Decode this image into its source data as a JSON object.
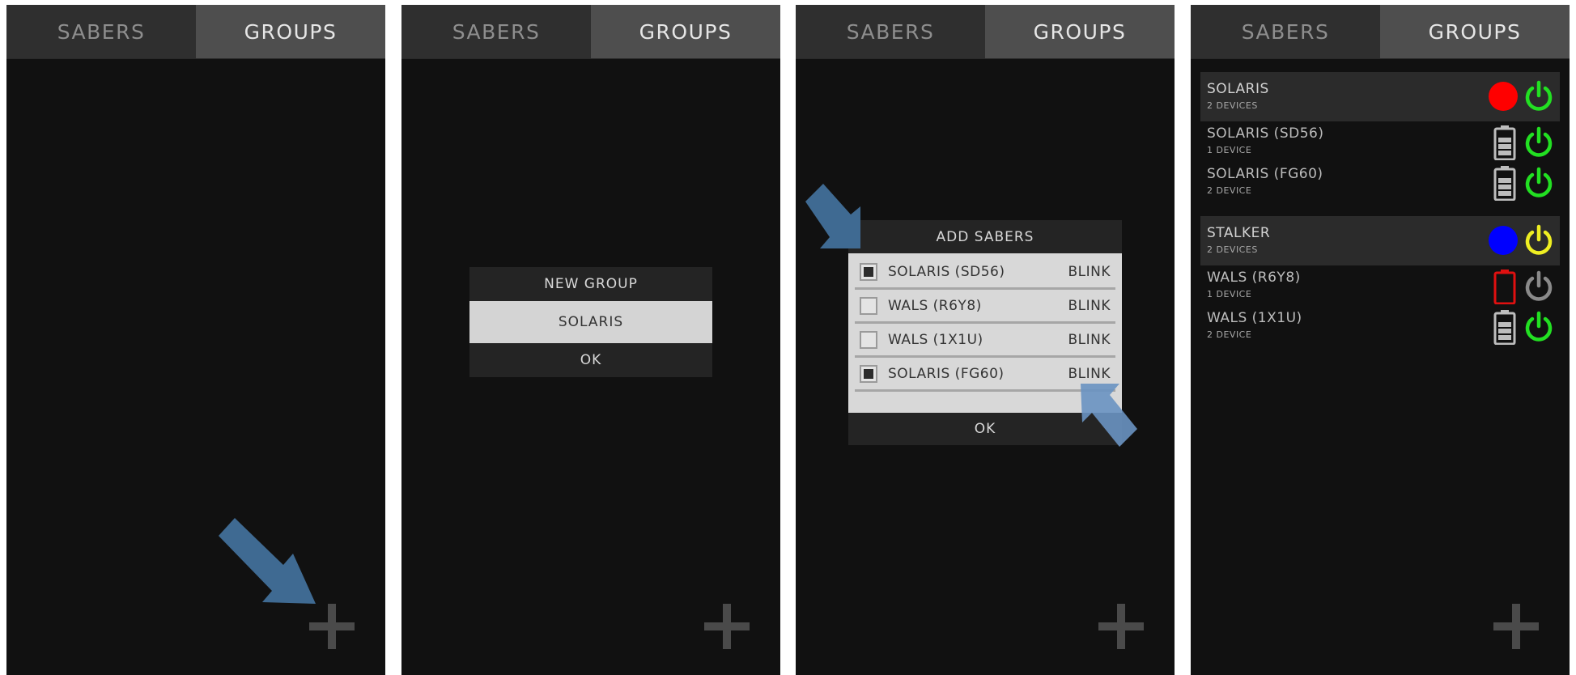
{
  "tabs": {
    "sabers": "SABERS",
    "groups": "GROUPS"
  },
  "colors": {
    "red": "#ff0000",
    "blue": "#0000ff",
    "green": "#22e022",
    "yellow": "#eeee22",
    "gray": "#8a8a8a",
    "arrow": "#3f6a92"
  },
  "new_group_dialog": {
    "title": "NEW GROUP",
    "input_value": "SOLARIS",
    "ok": "OK"
  },
  "add_sabers_dialog": {
    "title": "ADD SABERS",
    "items": [
      {
        "name": "SOLARIS (SD56)",
        "action": "BLINK",
        "checked": true
      },
      {
        "name": "WALS (R6Y8)",
        "action": "BLINK",
        "checked": false
      },
      {
        "name": "WALS (1X1U)",
        "action": "BLINK",
        "checked": false
      },
      {
        "name": "SOLARIS (FG60)",
        "action": "BLINK",
        "checked": true
      }
    ],
    "ok": "OK"
  },
  "groups": [
    {
      "name": "SOLARIS",
      "subtitle": "2 DEVICES",
      "color": "red",
      "power": "on",
      "devices": [
        {
          "name": "SOLARIS (SD56)",
          "subtitle": "1 DEVICE",
          "battery": "full",
          "power": "on"
        },
        {
          "name": "SOLARIS (FG60)",
          "subtitle": "2 DEVICE",
          "battery": "full",
          "power": "on"
        }
      ]
    },
    {
      "name": "STALKER",
      "subtitle": "2 DEVICES",
      "color": "blue",
      "power": "yellow",
      "devices": [
        {
          "name": "WALS (R6Y8)",
          "subtitle": "1 DEVICE",
          "battery": "empty",
          "power": "off"
        },
        {
          "name": "WALS (1X1U)",
          "subtitle": "2 DEVICE",
          "battery": "full",
          "power": "on"
        }
      ]
    }
  ]
}
